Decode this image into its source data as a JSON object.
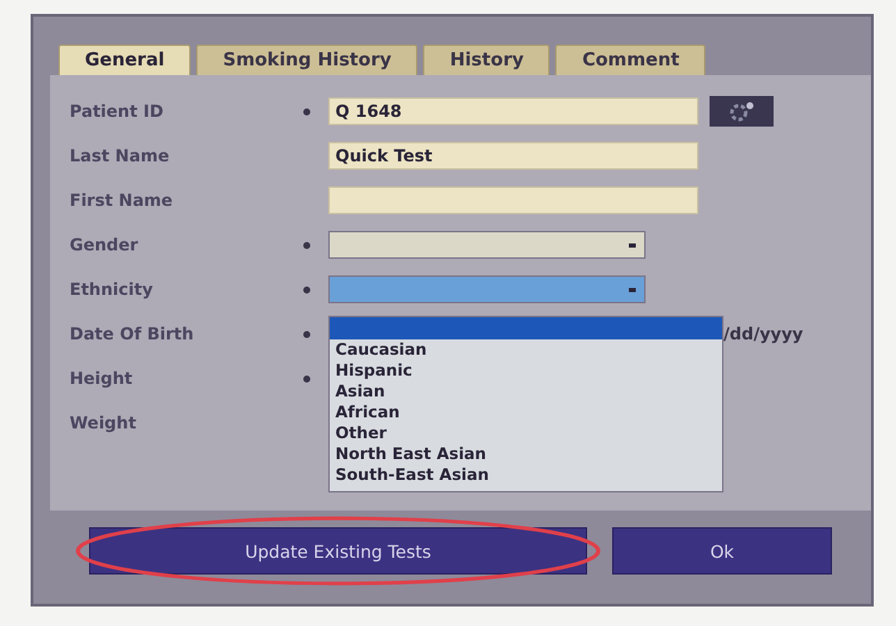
{
  "tabs": [
    {
      "label": "General",
      "selected": true
    },
    {
      "label": "Smoking History",
      "selected": false
    },
    {
      "label": "History",
      "selected": false
    },
    {
      "label": "Comment",
      "selected": false
    }
  ],
  "fields": [
    {
      "label": "Patient ID",
      "required": true,
      "kind": "text",
      "value": "Q 1648",
      "lookup_button": true
    },
    {
      "label": "Last Name",
      "required": false,
      "kind": "text",
      "value": "Quick Test"
    },
    {
      "label": "First Name",
      "required": false,
      "kind": "text"
    },
    {
      "label": "Gender",
      "required": true,
      "kind": "select"
    },
    {
      "label": "Ethnicity",
      "required": true,
      "kind": "select",
      "expanded": true
    },
    {
      "label": "Date Of Birth",
      "required": true,
      "kind": "date",
      "visible_text": "/dd/yyyy"
    },
    {
      "label": "Height",
      "required": true,
      "kind": "hidden"
    },
    {
      "label": "Weight",
      "required": false,
      "kind": "hidden"
    }
  ],
  "ethnicity_options": [
    "Caucasian",
    "Hispanic",
    "Asian",
    "African",
    "Other",
    "North East Asian",
    "South-East Asian"
  ],
  "buttons": [
    {
      "label": "Update Existing Tests",
      "circled": true
    },
    {
      "label": "Ok",
      "circled": false
    }
  ]
}
